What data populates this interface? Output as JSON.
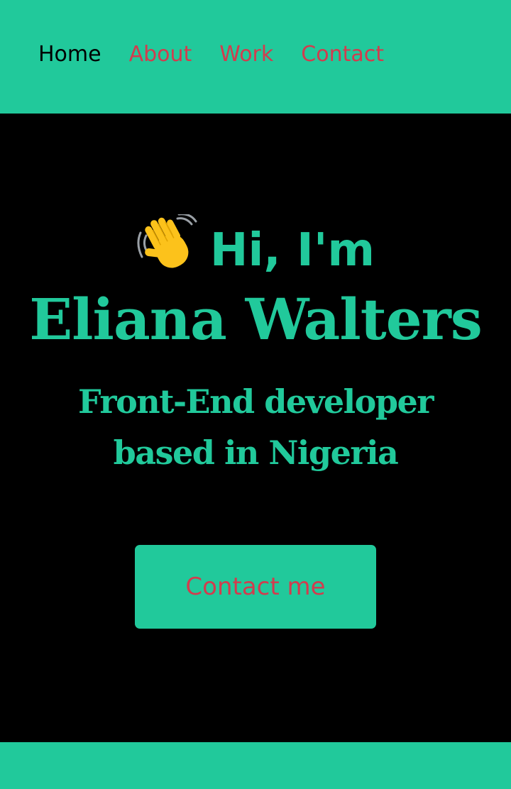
{
  "nav": {
    "items": [
      {
        "label": "Home",
        "active": true
      },
      {
        "label": "About",
        "active": false
      },
      {
        "label": "Work",
        "active": false
      },
      {
        "label": "Contact",
        "active": false
      }
    ]
  },
  "hero": {
    "greeting_icon": "waving-hand-icon",
    "greeting_text": "Hi, I'm",
    "name": "Eliana Walters",
    "tagline": "Front-End developer based in Nigeria",
    "cta_label": "Contact me"
  },
  "colors": {
    "accent": "#21c99b",
    "link": "#d23c4e",
    "background": "#000000",
    "active_link": "#000000"
  }
}
